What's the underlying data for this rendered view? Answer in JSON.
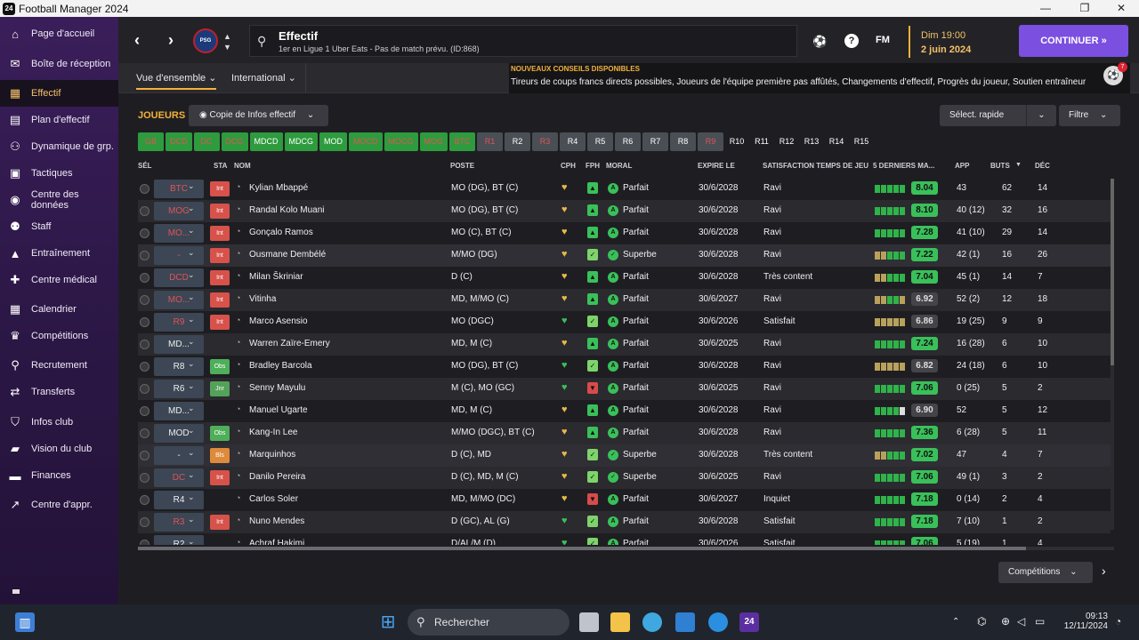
{
  "window": {
    "app_logo": "24",
    "title": "Football Manager 2024",
    "min": "—",
    "max": "❐",
    "close": "✕"
  },
  "sidebar": {
    "items": [
      {
        "label": "Page d'accueil",
        "icon": "⌂"
      },
      {
        "label": "Boîte de réception",
        "icon": "✉"
      },
      {
        "label": "Effectif",
        "icon": "▦",
        "active": true
      },
      {
        "label": "Plan d'effectif",
        "icon": "▤"
      },
      {
        "label": "Dynamique de grp.",
        "icon": "⚇"
      },
      {
        "label": "Tactiques",
        "icon": "▣"
      },
      {
        "label": "Centre des données",
        "icon": "◉"
      },
      {
        "label": "Staff",
        "icon": "⚉"
      },
      {
        "label": "Entraînement",
        "icon": "▲"
      },
      {
        "label": "Centre médical",
        "icon": "✚"
      },
      {
        "label": "Calendrier",
        "icon": "▦"
      },
      {
        "label": "Compétitions",
        "icon": "♛"
      },
      {
        "label": "Recrutement",
        "icon": "⚲"
      },
      {
        "label": "Transferts",
        "icon": "⇄"
      },
      {
        "label": "Infos club",
        "icon": "⛉"
      },
      {
        "label": "Vision du club",
        "icon": "▰"
      },
      {
        "label": "Finances",
        "icon": "▬"
      },
      {
        "label": "Centre d'appr.",
        "icon": "↗"
      }
    ]
  },
  "header": {
    "title": "Effectif",
    "subtitle": "1er en Ligue 1 Uber Eats - Pas de match prévu. (ID:868)",
    "date_line1": "Dim 19:00",
    "date_line2": "2 juin 2024",
    "continue": "CONTINUER",
    "continue_icon": "»",
    "fm": "FM",
    "help": "?",
    "club_badge": "PSG",
    "back_icon": "‹",
    "forward_icon": "›",
    "up_icon": "▲",
    "down_icon": "▼",
    "search_icon": "⚲",
    "ball_icon": "⚽"
  },
  "subnav": {
    "tab1": "Vue d'ensemble",
    "tab2": "International"
  },
  "news": {
    "heading": "NOUVEAUX CONSEILS DISPONIBLES",
    "body": "Tireurs de coups francs directs possibles, Joueurs de l'équipe première pas affûtés, Changements d'effectif, Progrès du joueur, Soutien entraîneur",
    "badge": "7"
  },
  "toolbar": {
    "players_label": "JOUEURS",
    "copy_label": "Copie de Infos effectif",
    "quick_select": "Sélect. rapide",
    "filter": "Filtre",
    "competitions": "Compétitions",
    "eye_icon": "◉",
    "chevron": "⌄"
  },
  "chips": [
    {
      "label": "GB",
      "style": "g",
      "color": "#e05454"
    },
    {
      "label": "DCD",
      "style": "g",
      "color": "#e05454"
    },
    {
      "label": "DC",
      "style": "g",
      "color": "#e05454"
    },
    {
      "label": "DCG",
      "style": "g",
      "color": "#e05454"
    },
    {
      "label": "MDCD",
      "style": "g",
      "color": "#ffffff"
    },
    {
      "label": "MDCG",
      "style": "g",
      "color": "#ffffff"
    },
    {
      "label": "MOD",
      "style": "g",
      "color": "#ffffff"
    },
    {
      "label": "MOCD",
      "style": "g",
      "color": "#e05454"
    },
    {
      "label": "MOCG",
      "style": "g",
      "color": "#e05454"
    },
    {
      "label": "MOG",
      "style": "g",
      "color": "#e05454"
    },
    {
      "label": "BTC",
      "style": "g",
      "color": "#e05454"
    },
    {
      "label": "R1",
      "style": "gr",
      "color": "#e05454"
    },
    {
      "label": "R2",
      "style": "gr",
      "color": "#ffffff"
    },
    {
      "label": "R3",
      "style": "gr",
      "color": "#e05454"
    },
    {
      "label": "R4",
      "style": "gr",
      "color": "#ffffff"
    },
    {
      "label": "R5",
      "style": "gr",
      "color": "#ffffff"
    },
    {
      "label": "R6",
      "style": "gr",
      "color": "#ffffff"
    },
    {
      "label": "R7",
      "style": "gr",
      "color": "#ffffff"
    },
    {
      "label": "R8",
      "style": "gr",
      "color": "#ffffff"
    },
    {
      "label": "R9",
      "style": "gr",
      "color": "#e05454"
    },
    {
      "label": "R10",
      "style": "n",
      "color": "#ffffff"
    },
    {
      "label": "R11",
      "style": "n",
      "color": "#ffffff"
    },
    {
      "label": "R12",
      "style": "n",
      "color": "#ffffff"
    },
    {
      "label": "R13",
      "style": "n",
      "color": "#ffffff"
    },
    {
      "label": "R14",
      "style": "n",
      "color": "#ffffff"
    },
    {
      "label": "R15",
      "style": "n",
      "color": "#ffffff"
    }
  ],
  "columns": [
    "SÉL",
    "STA",
    "NOM",
    "POSTE",
    "CPH",
    "FPH",
    "MORAL",
    "EXPIRE LE",
    "SATISFACTION TEMPS DE JEU",
    "5 DERNIERS MA...",
    "APP",
    "BUTS",
    "DÉC"
  ],
  "players": [
    {
      "pos": "BTC",
      "pc": "red",
      "sta": "Int",
      "st": "int",
      "name": "Kylian Mbappé",
      "poste": "MO (DG), BT (C)",
      "cph": "y",
      "fph": "g",
      "fphi": "▲",
      "moral": "Parfait",
      "mi": "A",
      "exp": "30/6/2028",
      "sat": "Ravi",
      "bars": "ggggg",
      "rating": "8.04",
      "rc": "g",
      "app": "43",
      "buts": "62",
      "dec": "14"
    },
    {
      "pos": "MOG",
      "pc": "red",
      "sta": "Int",
      "st": "int",
      "name": "Randal Kolo Muani",
      "poste": "MO (DG), BT (C)",
      "cph": "y",
      "fph": "g",
      "fphi": "▲",
      "moral": "Parfait",
      "mi": "A",
      "exp": "30/6/2028",
      "sat": "Ravi",
      "bars": "ggggg",
      "rating": "8.10",
      "rc": "g",
      "app": "40 (12)",
      "buts": "32",
      "dec": "16"
    },
    {
      "pos": "MO...",
      "pc": "red",
      "sta": "Int",
      "st": "int",
      "name": "Gonçalo Ramos",
      "poste": "MO (C), BT (C)",
      "cph": "y",
      "fph": "g",
      "fphi": "▲",
      "moral": "Parfait",
      "mi": "A",
      "exp": "30/6/2028",
      "sat": "Ravi",
      "bars": "ggggg",
      "rating": "7.28",
      "rc": "g",
      "app": "41 (10)",
      "buts": "29",
      "dec": "14"
    },
    {
      "pos": "-",
      "pc": "red",
      "sta": "Int",
      "st": "int",
      "name": "Ousmane Dembélé",
      "poste": "M/MO (DG)",
      "cph": "y",
      "fph": "lg",
      "fphi": "✓",
      "moral": "Superbe",
      "mi": "✓",
      "exp": "30/6/2028",
      "sat": "Ravi",
      "bars": "yyggg",
      "rating": "7.22",
      "rc": "g",
      "app": "42 (1)",
      "buts": "16",
      "dec": "26"
    },
    {
      "pos": "DCD",
      "pc": "red",
      "sta": "Int",
      "st": "int",
      "name": "Milan Škriniar",
      "poste": "D (C)",
      "cph": "y",
      "fph": "g",
      "fphi": "▲",
      "moral": "Parfait",
      "mi": "A",
      "exp": "30/6/2028",
      "sat": "Très content",
      "bars": "yyggg",
      "rating": "7.04",
      "rc": "g",
      "app": "45 (1)",
      "buts": "14",
      "dec": "7"
    },
    {
      "pos": "MO...",
      "pc": "red",
      "sta": "Int",
      "st": "int",
      "name": "Vitinha",
      "poste": "MD, M/MO (C)",
      "cph": "y",
      "fph": "g",
      "fphi": "▲",
      "moral": "Parfait",
      "mi": "A",
      "exp": "30/6/2027",
      "sat": "Ravi",
      "bars": "yyggy",
      "rating": "6.92",
      "rc": "gray",
      "app": "52 (2)",
      "buts": "12",
      "dec": "18"
    },
    {
      "pos": "R9",
      "pc": "red",
      "sta": "Int",
      "st": "int",
      "name": "Marco Asensio",
      "poste": "MO (DGC)",
      "cph": "g",
      "fph": "lg",
      "fphi": "✓",
      "moral": "Parfait",
      "mi": "A",
      "exp": "30/6/2026",
      "sat": "Satisfait",
      "bars": "yyyyy",
      "rating": "6.86",
      "rc": "gray",
      "app": "19 (25)",
      "buts": "9",
      "dec": "9"
    },
    {
      "pos": "MD...",
      "pc": "white",
      "sta": "",
      "st": "",
      "name": "Warren Zaïre-Emery",
      "poste": "MD, M (C)",
      "cph": "y",
      "fph": "g",
      "fphi": "▲",
      "moral": "Parfait",
      "mi": "A",
      "exp": "30/6/2025",
      "sat": "Ravi",
      "bars": "ggggg",
      "rating": "7.24",
      "rc": "g",
      "app": "16 (28)",
      "buts": "6",
      "dec": "10"
    },
    {
      "pos": "R8",
      "pc": "white",
      "sta": "Obs",
      "st": "obs",
      "name": "Bradley Barcola",
      "poste": "MO (DG), BT (C)",
      "cph": "g",
      "fph": "lg",
      "fphi": "✓",
      "moral": "Parfait",
      "mi": "A",
      "exp": "30/6/2028",
      "sat": "Ravi",
      "bars": "yyyyy",
      "rating": "6.82",
      "rc": "gray",
      "app": "24 (18)",
      "buts": "6",
      "dec": "10"
    },
    {
      "pos": "R6",
      "pc": "white",
      "sta": "Jnr",
      "st": "jnr",
      "name": "Senny Mayulu",
      "poste": "M (C), MO (GC)",
      "cph": "g",
      "fph": "r",
      "fphi": "▼",
      "moral": "Parfait",
      "mi": "A",
      "exp": "30/6/2025",
      "sat": "Ravi",
      "bars": "ggggg",
      "rating": "7.06",
      "rc": "g",
      "app": "0 (25)",
      "buts": "5",
      "dec": "2"
    },
    {
      "pos": "MD...",
      "pc": "white",
      "sta": "",
      "st": "",
      "name": "Manuel Ugarte",
      "poste": "MD, M (C)",
      "cph": "y",
      "fph": "g",
      "fphi": "▲",
      "moral": "Parfait",
      "mi": "A",
      "exp": "30/6/2028",
      "sat": "Ravi",
      "bars": "ggggw",
      "rating": "6.90",
      "rc": "gray",
      "app": "52",
      "buts": "5",
      "dec": "12"
    },
    {
      "pos": "MOD",
      "pc": "white",
      "sta": "Obs",
      "st": "obs",
      "name": "Kang-In Lee",
      "poste": "M/MO (DGC), BT (C)",
      "cph": "y",
      "fph": "g",
      "fphi": "▲",
      "moral": "Parfait",
      "mi": "A",
      "exp": "30/6/2028",
      "sat": "Ravi",
      "bars": "ggggg",
      "rating": "7.36",
      "rc": "g",
      "app": "6 (28)",
      "buts": "5",
      "dec": "11"
    },
    {
      "pos": "-",
      "pc": "white",
      "sta": "Bls",
      "st": "bls",
      "name": "Marquinhos",
      "poste": "D (C), MD",
      "cph": "y",
      "fph": "lg",
      "fphi": "✓",
      "moral": "Superbe",
      "mi": "✓",
      "exp": "30/6/2028",
      "sat": "Très content",
      "bars": "yyggg",
      "rating": "7.02",
      "rc": "g",
      "app": "47",
      "buts": "4",
      "dec": "7"
    },
    {
      "pos": "DC",
      "pc": "red",
      "sta": "Int",
      "st": "int",
      "name": "Danilo Pereira",
      "poste": "D (C), MD, M (C)",
      "cph": "y",
      "fph": "lg",
      "fphi": "✓",
      "moral": "Superbe",
      "mi": "✓",
      "exp": "30/6/2025",
      "sat": "Ravi",
      "bars": "ggggg",
      "rating": "7.06",
      "rc": "g",
      "app": "49 (1)",
      "buts": "3",
      "dec": "2"
    },
    {
      "pos": "R4",
      "pc": "white",
      "sta": "",
      "st": "",
      "name": "Carlos Soler",
      "poste": "MD, M/MO (DC)",
      "cph": "y",
      "fph": "r",
      "fphi": "▼",
      "moral": "Parfait",
      "mi": "A",
      "exp": "30/6/2027",
      "sat": "Inquiet",
      "bars": "ggggg",
      "rating": "7.18",
      "rc": "g",
      "app": "0 (14)",
      "buts": "2",
      "dec": "4"
    },
    {
      "pos": "R3",
      "pc": "red",
      "sta": "Int",
      "st": "int",
      "name": "Nuno Mendes",
      "poste": "D (GC), AL (G)",
      "cph": "g",
      "fph": "lg",
      "fphi": "✓",
      "moral": "Parfait",
      "mi": "A",
      "exp": "30/6/2028",
      "sat": "Satisfait",
      "bars": "ggggg",
      "rating": "7.18",
      "rc": "g",
      "app": "7 (10)",
      "buts": "1",
      "dec": "2"
    },
    {
      "pos": "R2",
      "pc": "white",
      "sta": "",
      "st": "",
      "name": "Achraf Hakimi",
      "poste": "D/AL/M (D)",
      "cph": "g",
      "fph": "lg",
      "fphi": "✓",
      "moral": "Parfait",
      "mi": "A",
      "exp": "30/6/2026",
      "sat": "Satisfait",
      "bars": "ggggg",
      "rating": "7.06",
      "rc": "g",
      "app": "5 (19)",
      "buts": "1",
      "dec": "4"
    }
  ],
  "taskbar": {
    "search": "Rechercher",
    "time": "09:13",
    "date": "12/11/2024",
    "app_badge": "24",
    "start_icon": "⊞"
  }
}
